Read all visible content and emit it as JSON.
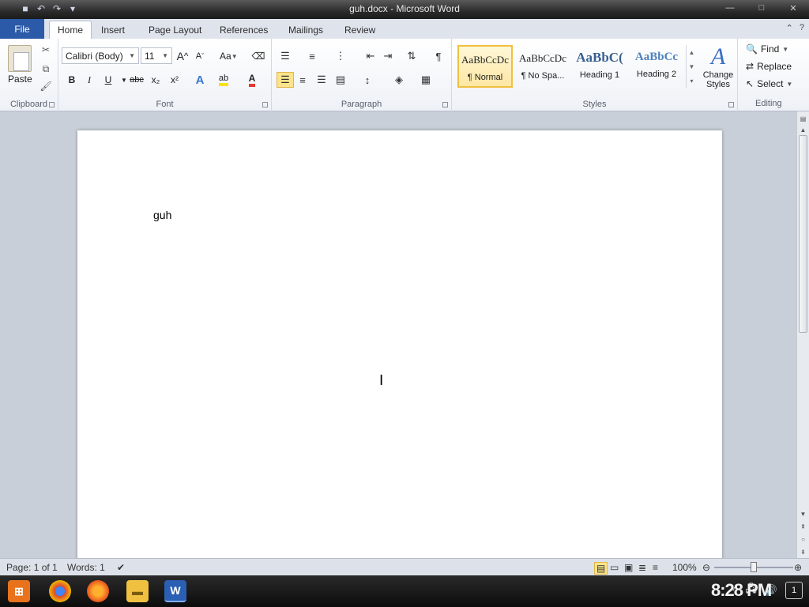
{
  "window": {
    "title": "guh.docx - Microsoft Word",
    "minimize": "—",
    "maximize": "□",
    "close": "✕"
  },
  "qat": {
    "save_icon": "save-icon",
    "undo_icon": "undo-icon",
    "redo_icon": "redo-icon"
  },
  "tabs": {
    "file": "File",
    "items": [
      "Home",
      "Insert",
      "Page Layout",
      "References",
      "Mailings",
      "Review"
    ],
    "active": "Home"
  },
  "clipboard": {
    "paste": "Paste",
    "label": "Clipboard"
  },
  "font": {
    "name": "Calibri (Body)",
    "size": "11",
    "grow": "A",
    "shrink": "A",
    "case": "Aa",
    "bold": "B",
    "italic": "I",
    "underline": "U",
    "strike": "abc",
    "subscript": "x₂",
    "superscript": "x²",
    "label": "Font",
    "font_color": "#e03b2e",
    "highlight_color": "#f5e21a"
  },
  "paragraph": {
    "label": "Paragraph",
    "pilcrow": "¶"
  },
  "styles": {
    "label": "Styles",
    "items": [
      {
        "sample": "AaBbCcDc",
        "name": "¶ Normal",
        "selected": true
      },
      {
        "sample": "AaBbCcDc",
        "name": "¶ No Spa..."
      },
      {
        "sample": "AaBbC(",
        "name": "Heading 1"
      },
      {
        "sample": "AaBbCc",
        "name": "Heading 2"
      }
    ],
    "change_styles": "Change Styles"
  },
  "editing": {
    "find": "Find",
    "replace": "Replace",
    "select": "Select",
    "label": "Editing"
  },
  "document": {
    "text": "guh"
  },
  "status": {
    "page": "Page: 1 of 1",
    "words": "Words: 1",
    "zoom": "100%",
    "zoom_level": 1.0
  },
  "taskbar": {
    "clock": "8:28 PM",
    "notifications": "1"
  }
}
